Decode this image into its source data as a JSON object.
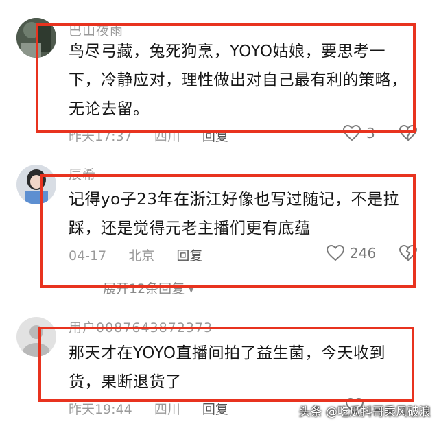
{
  "comments": [
    {
      "username": "巴山夜雨",
      "content": "鸟尽弓藏，兔死狗烹，YOYO姑娘，要思考一下，冷静应对，理性做出对自己最有利的策略，无论去留。",
      "time": "昨天17:37",
      "location": "四川",
      "reply_label": "回复",
      "likes": "3"
    },
    {
      "username": "辰希",
      "content": "记得yo子23年在浙江好像也写过随记，不是拉踩，还是觉得元老主播们更有底蕴",
      "time": "04-17",
      "location": "北京",
      "reply_label": "回复",
      "likes": "246",
      "expand_label": "展开12条回复"
    },
    {
      "username": "用户0087643872373",
      "content": "那天才在YOYO直播间拍了益生菌，今天收到货，果断退货了",
      "time": "昨天19:44",
      "location": "四川",
      "reply_label": "回复",
      "likes": ""
    }
  ],
  "watermark": "头条 @吃瓜抖哥乘风破浪",
  "colors": {
    "highlight": "#e8331f",
    "meta": "#9a9a9a",
    "text": "#161616"
  }
}
